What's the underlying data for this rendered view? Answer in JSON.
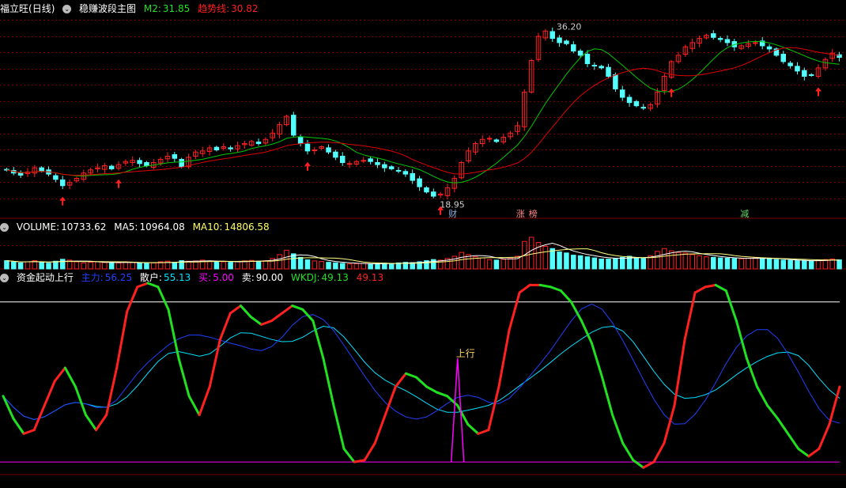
{
  "main_panel": {
    "stock_name": "福立旺",
    "period": "(日线)",
    "indicator": "稳赚波段主图",
    "m2_label": "M2:",
    "m2_value": "31.85",
    "trend_label": "趋势线:",
    "trend_value": "30.82",
    "high_label": "36.20",
    "low_label": "18.95",
    "markers": [
      "财",
      "涨",
      "榜",
      "减"
    ]
  },
  "volume_panel": {
    "volume_label": "VOLUME:",
    "volume_value": "10733.62",
    "ma5_label": "MA5:",
    "ma5_value": "10964.08",
    "ma10_label": "MA10:",
    "ma10_value": "14806.58"
  },
  "indicator_panel": {
    "name": "资金起动上行",
    "zhuli_label": "主力:",
    "zhuli_value": "56.25",
    "sanhu_label": "散户:",
    "sanhu_value": "55.13",
    "buy_label": "买:",
    "buy_value": "5.00",
    "sell_label": "卖:",
    "sell_value": "90.00",
    "wkdj_label": "WKDJ:",
    "wkdj_value": "49.13",
    "wkdj_value2": "49.13",
    "signal_label": "上行"
  },
  "colors": {
    "up": "#ff2020",
    "down": "#54ffff",
    "grid": "#7a0000",
    "ma_green": "#00c800",
    "trend_red": "#e00000",
    "ma10_yellow": "#ffff80",
    "zhuli_blue": "#2040ff",
    "sanhu_cyan": "#00e0ff",
    "buy_magenta": "#ff00ff",
    "wkdj_green": "#20e020"
  },
  "chart_data": {
    "type": "candlestick",
    "price_high": 36.2,
    "price_low": 18.95,
    "closes": [
      22.1,
      21.8,
      21.6,
      21.9,
      22.3,
      22.0,
      21.7,
      21.2,
      20.6,
      20.9,
      21.3,
      21.8,
      22.1,
      22.3,
      22.5,
      22.2,
      22.6,
      22.9,
      23.0,
      22.7,
      22.5,
      22.8,
      23.1,
      23.4,
      23.2,
      22.4,
      23.3,
      23.8,
      23.9,
      24.2,
      24.0,
      24.3,
      24.1,
      24.4,
      24.6,
      24.8,
      24.6,
      25.0,
      25.6,
      26.4,
      27.2,
      25.4,
      24.6,
      23.9,
      24.0,
      24.3,
      23.8,
      23.3,
      22.8,
      22.7,
      22.9,
      23.0,
      22.9,
      22.6,
      22.3,
      22.2,
      22.0,
      21.7,
      21.1,
      20.5,
      20.0,
      19.6,
      19.8,
      20.4,
      21.3,
      22.8,
      23.9,
      24.6,
      25.0,
      25.1,
      24.8,
      25.2,
      25.6,
      26.3,
      29.5,
      32.5,
      34.8,
      35.3,
      34.6,
      34.2,
      34.1,
      33.4,
      33.0,
      32.2,
      32.0,
      31.8,
      31.0,
      29.8,
      29.0,
      28.5,
      28.2,
      28.0,
      28.3,
      29.5,
      31.0,
      32.4,
      33.0,
      33.8,
      34.2,
      34.6,
      34.9,
      34.7,
      34.5,
      34.2,
      33.8,
      33.9,
      34.1,
      34.2,
      33.9,
      33.6,
      33.0,
      32.4,
      32.0,
      31.5,
      31.0,
      31.1,
      31.8,
      32.6,
      33.2,
      32.8
    ],
    "volume": [
      3,
      2.5,
      2.2,
      2.6,
      3,
      2.4,
      2.1,
      2.8,
      3.5,
      3.2,
      2.6,
      2.2,
      2.4,
      2.6,
      2.3,
      2.1,
      2.2,
      2.6,
      2.4,
      2.2,
      2.0,
      2.2,
      2.6,
      2.8,
      2.4,
      3.0,
      2.8,
      2.9,
      3.2,
      2.8,
      2.5,
      2.6,
      2.4,
      2.7,
      2.9,
      3.1,
      2.8,
      3.0,
      3.8,
      5.2,
      6.8,
      5.5,
      4.2,
      3.3,
      2.9,
      2.7,
      2.4,
      2.2,
      2.0,
      1.8,
      1.9,
      2.0,
      1.8,
      1.9,
      2.1,
      2.0,
      2.2,
      2.4,
      2.3,
      2.6,
      3.0,
      3.4,
      3.2,
      3.8,
      4.6,
      6.0,
      5.2,
      4.4,
      4.0,
      3.4,
      3.2,
      3.5,
      4.0,
      4.6,
      10.0,
      11.5,
      9.6,
      8.2,
      7.4,
      6.2,
      5.8,
      5.0,
      4.8,
      4.4,
      4.0,
      3.6,
      3.6,
      3.8,
      4.2,
      4.6,
      4.0,
      3.8,
      4.8,
      6.4,
      7.4,
      6.6,
      6.0,
      5.8,
      5.2,
      4.8,
      4.4,
      4.2,
      4.0,
      3.9,
      3.8,
      3.7,
      3.9,
      4.1,
      3.8,
      3.6,
      3.4,
      3.2,
      3.1,
      3.0,
      2.9,
      2.8,
      3.2,
      3.4,
      3.6,
      3.3
    ],
    "kdj": [
      40,
      28,
      20,
      22,
      35,
      48,
      55,
      45,
      30,
      22,
      30,
      55,
      85,
      98,
      100,
      98,
      86,
      60,
      40,
      30,
      45,
      70,
      84,
      88,
      82,
      78,
      80,
      84,
      88,
      86,
      80,
      60,
      35,
      12,
      5,
      6,
      15,
      30,
      45,
      52,
      50,
      45,
      42,
      40,
      35,
      25,
      20,
      22,
      45,
      75,
      95,
      99,
      99,
      98,
      96,
      90,
      80,
      68,
      50,
      30,
      15,
      6,
      2,
      5,
      15,
      35,
      70,
      95,
      98,
      99,
      96,
      80,
      60,
      45,
      35,
      28,
      20,
      12,
      8,
      12,
      25,
      45
    ]
  }
}
